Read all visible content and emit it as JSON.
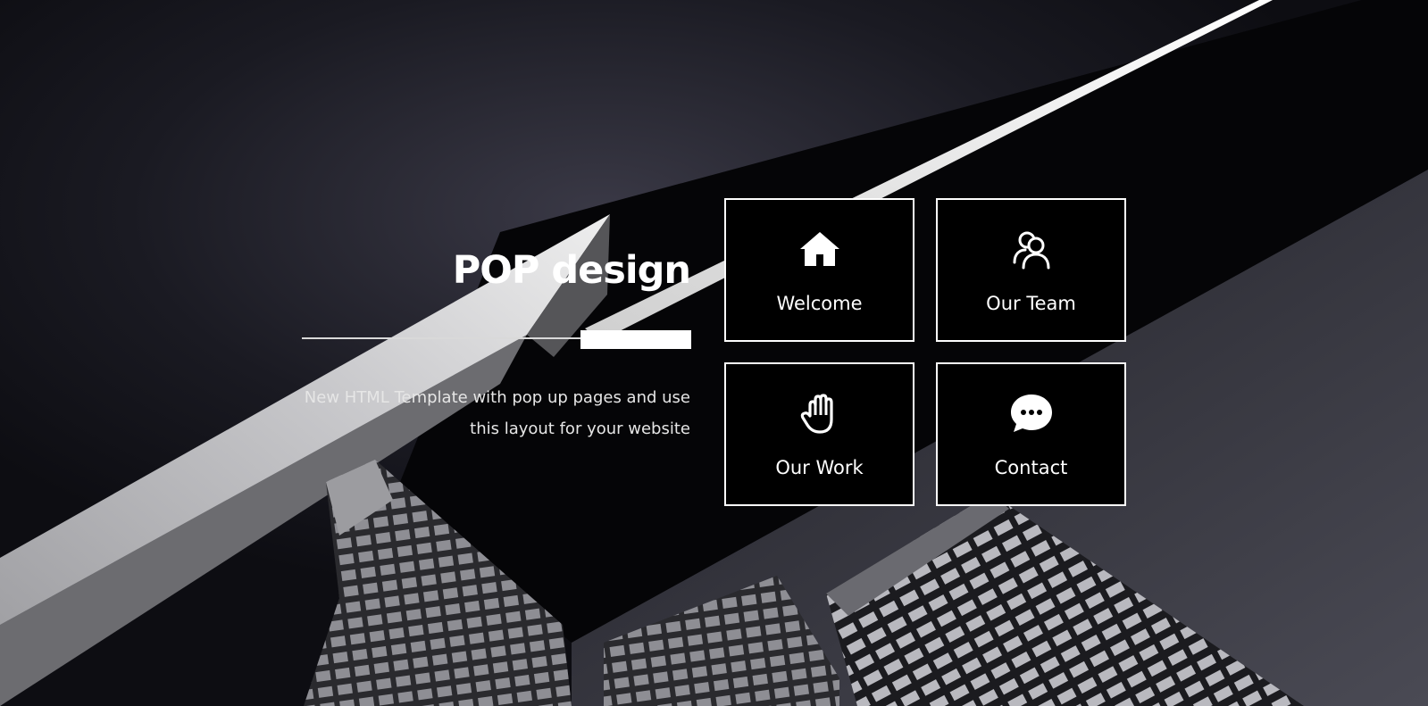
{
  "hero": {
    "title": "POP design",
    "tagline": "New HTML Template with pop up pages and use this layout for your website"
  },
  "nav": {
    "tiles": [
      {
        "label": "Welcome",
        "icon": "home-icon"
      },
      {
        "label": "Our Team",
        "icon": "users-icon"
      },
      {
        "label": "Our Work",
        "icon": "hand-icon"
      },
      {
        "label": "Contact",
        "icon": "chat-icon"
      }
    ]
  },
  "colors": {
    "tile_background": "#000000",
    "tile_border": "#ffffff",
    "text": "#ffffff"
  }
}
